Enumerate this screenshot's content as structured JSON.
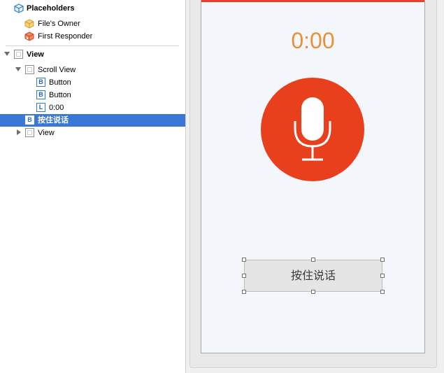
{
  "outline": {
    "placeholders_header": "Placeholders",
    "files_owner": "File's Owner",
    "first_responder": "First Responder",
    "view": "View",
    "scroll_view": "Scroll View",
    "button_1": "Button",
    "button_2": "Button",
    "label_time": "0:00",
    "talk_button": "按住说话",
    "sub_view": "View",
    "icon_letters": {
      "button": "B",
      "label": "L"
    }
  },
  "canvas": {
    "timer": "0:00",
    "talk_button_label": "按住说话"
  },
  "colors": {
    "selection": "#3b77d6",
    "accent_red": "#e8401c",
    "timer_orange": "#e6913a"
  },
  "icons": {
    "placeholders": "cube-icon",
    "files_owner": "yellow-cube-icon",
    "first_responder": "red-cube-icon",
    "view": "view-box-icon",
    "microphone": "microphone-icon"
  }
}
